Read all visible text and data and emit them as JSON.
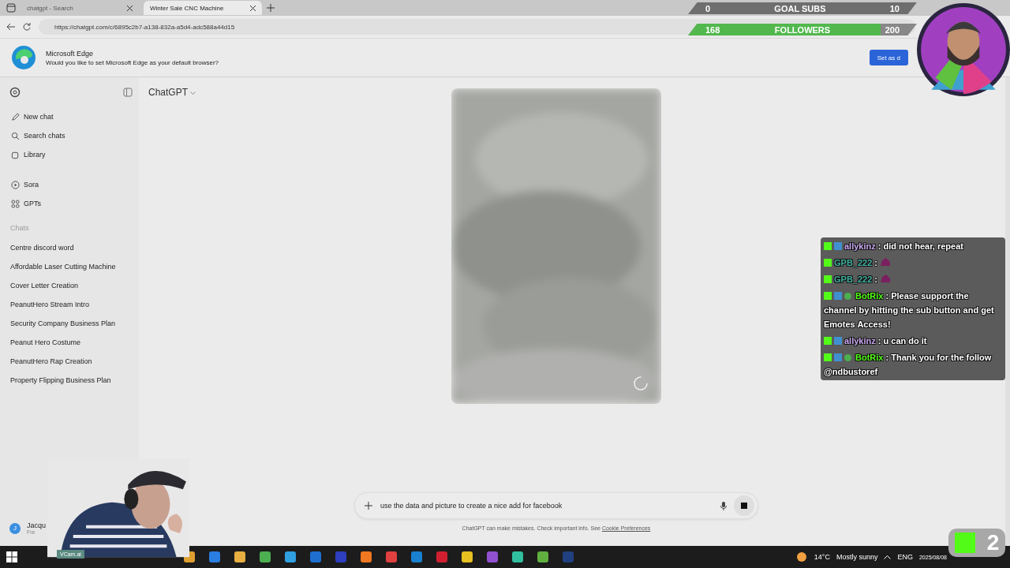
{
  "browser": {
    "tabs": [
      {
        "title": "chatgpt - Search",
        "selected": false
      },
      {
        "title": "Winter Sale CNC Machine",
        "selected": true
      }
    ],
    "url": "https://chatgpt.com/c/6895c2b7-a138-832a-a5d4-adc588a44d15"
  },
  "edge_banner": {
    "title": "Microsoft Edge",
    "message": "Would you like to set Microsoft Edge as your default browser?",
    "button": "Set as d"
  },
  "sidebar": {
    "nav": [
      {
        "label": "New chat"
      },
      {
        "label": "Search chats"
      },
      {
        "label": "Library"
      },
      {
        "label": "Sora"
      },
      {
        "label": "GPTs"
      }
    ],
    "chats_heading": "Chats",
    "chats": [
      "Centre discord word",
      "Affordable Laser Cutting Machine",
      "Cover Letter Creation",
      "PeanutHero Stream Intro",
      "Security Company Business Plan",
      "Peanut Hero Costume",
      "PeanutHero Rap Creation",
      "Property Flipping Business Plan"
    ],
    "user": {
      "initial": "J",
      "name": "Jacqu",
      "plan": "Fre"
    }
  },
  "main": {
    "model": "ChatGPT",
    "image": {
      "kind": "picture",
      "loading": true
    },
    "composer": {
      "value": "use the data and picture to create a nice add for facebook"
    },
    "disclaimer": "ChatGPT can make mistakes. Check important info. See ",
    "disclaimer_link": "Cookie Preferences"
  },
  "overlay": {
    "goals": [
      {
        "current": "0",
        "label": "GOAL SUBS",
        "target": "10",
        "level": 0
      },
      {
        "current": "168",
        "label": "FOLLOWERS",
        "target": "200",
        "level": 0.84
      }
    ],
    "chat": [
      {
        "user": "allykinz",
        "color": "#c8a8f0",
        "verified": false,
        "kind": "text",
        "text": " : did not hear, repeat"
      },
      {
        "user": "GPB_222",
        "color": "#40b0a0",
        "verified": false,
        "kind": "emote",
        "text": " : "
      },
      {
        "user": "GPB_222",
        "color": "#40b0a0",
        "verified": false,
        "kind": "emote",
        "text": " : "
      },
      {
        "user": "BotRix",
        "color": "#53fc18",
        "verified": true,
        "kind": "text",
        "text": " : Please support the channel by hitting the sub button and get Emotes Access!"
      },
      {
        "user": "allykinz",
        "color": "#c8a8f0",
        "verified": false,
        "kind": "text",
        "text": " : u can do it"
      },
      {
        "user": "BotRix",
        "color": "#53fc18",
        "verified": true,
        "kind": "text",
        "text": " : Thank you for the follow @ndbustoref"
      }
    ],
    "viewer_count": "2",
    "webcam_label": "VCam.ai"
  },
  "taskbar": {
    "weather": "14°C",
    "condition": "Mostly sunny",
    "language": "ENG",
    "date": "2025/08/08"
  }
}
